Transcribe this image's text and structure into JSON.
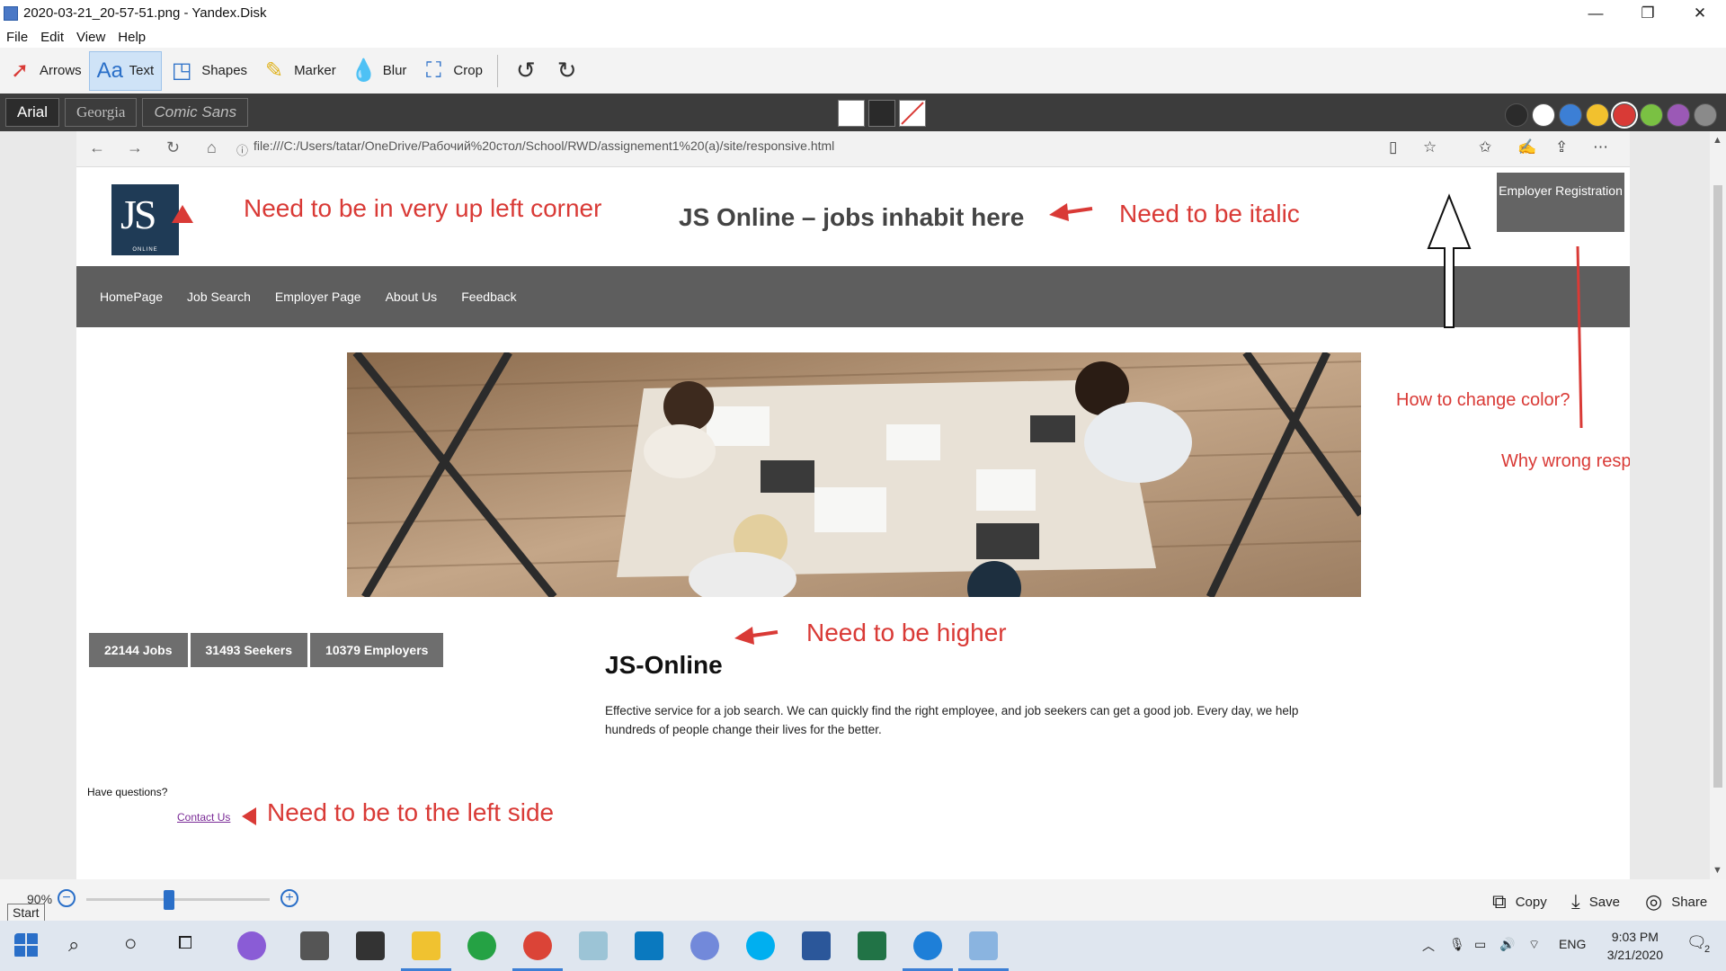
{
  "window": {
    "title": "2020-03-21_20-57-51.png - Yandex.Disk",
    "controls": [
      "—",
      "❐",
      "✕"
    ]
  },
  "menu": [
    "File",
    "Edit",
    "View",
    "Help"
  ],
  "toolbar": {
    "tools": [
      {
        "label": "Arrows",
        "icon": "arrow-icon"
      },
      {
        "label": "Text",
        "icon": "text-icon",
        "active": true
      },
      {
        "label": "Shapes",
        "icon": "shapes-icon"
      },
      {
        "label": "Marker",
        "icon": "marker-icon"
      },
      {
        "label": "Blur",
        "icon": "blur-icon"
      },
      {
        "label": "Crop",
        "icon": "crop-icon"
      }
    ]
  },
  "fonts": [
    "Arial",
    "Georgia",
    "Comic Sans"
  ],
  "colors": {
    "palette": [
      "#2b2b2b",
      "#ffffff",
      "#3c7fd5",
      "#f2c12e",
      "#d93a36",
      "#7ac143",
      "#9b59b6",
      "#8a8a8a"
    ],
    "accent": "#d93a36"
  },
  "browser": {
    "url": "file:///C:/Users/tatar/OneDrive/Рабочий%20стол/School/RWD/assignement1%20(a)/site/responsive.html"
  },
  "site": {
    "logo_text": "JS",
    "logo_sub": "ONLINE",
    "title": "JS Online – jobs inhabit here",
    "employer_button": "Employer Registration",
    "nav": [
      "HomePage",
      "Job Search",
      "Employer Page",
      "About Us",
      "Feedback"
    ],
    "stats": [
      "22144 Jobs",
      "31493 Seekers",
      "10379 Employers"
    ],
    "heading": "JS-Online",
    "description": "Effective service for a job search. We can quickly find the right employee, and job seekers can get a good job. Every day, we help hundreds of people change their lives for the better.",
    "questions": "Have questions?",
    "contact": "Contact Us"
  },
  "annotations": {
    "corner": "Need to be in very up left corner",
    "italic": "Need to be italic",
    "color": "How to change color?",
    "responsive": "Why wrong responsive?",
    "higher": "Need to be higher",
    "left": "Need to be to the left side"
  },
  "bottom": {
    "zoom": "90%",
    "zoom_level": 0.45,
    "start_tip": "Start",
    "copy": "Copy",
    "save": "Save",
    "share": "Share"
  },
  "tray": {
    "lang": "ENG",
    "time": "9:03 PM",
    "date": "3/21/2020",
    "notifications": "2"
  }
}
